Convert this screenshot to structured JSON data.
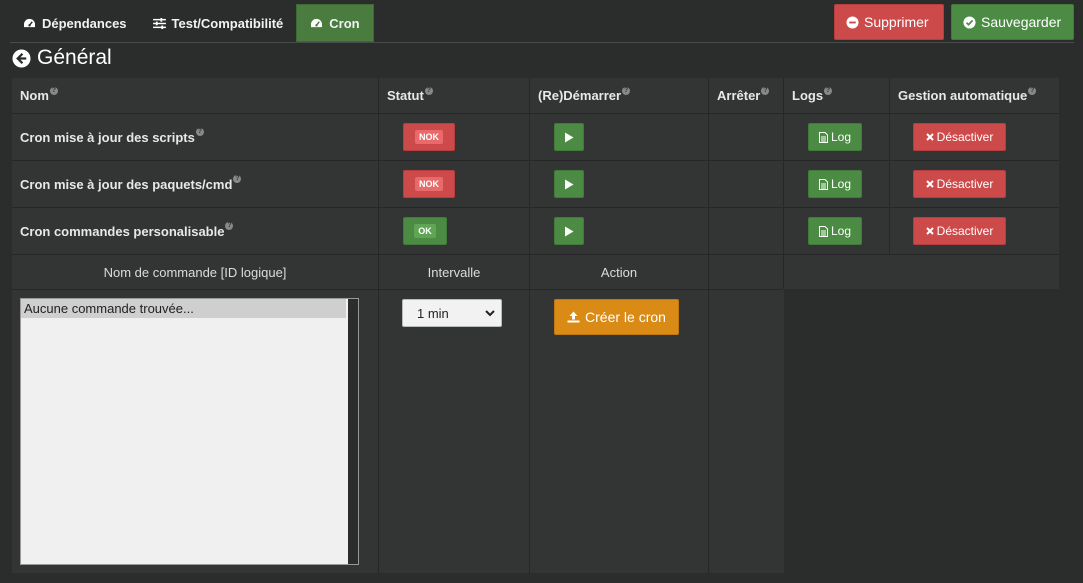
{
  "tabs": [
    {
      "label": "Dépendances",
      "icon": "dashboard-icon"
    },
    {
      "label": "Test/Compatibilité",
      "icon": "sliders-icon"
    },
    {
      "label": "Cron",
      "icon": "dashboard-icon",
      "active": true
    }
  ],
  "actions": {
    "delete_label": "Supprimer",
    "save_label": "Sauvegarder"
  },
  "section": {
    "title": "Général",
    "icon": "arrow-circle-left-icon"
  },
  "table": {
    "headers": {
      "name": "Nom",
      "status": "Statut",
      "restart": "(Re)Démarrer",
      "stop": "Arrêter",
      "logs": "Logs",
      "auto": "Gestion automatique"
    },
    "rows": [
      {
        "name": "Cron mise à jour des scripts",
        "status": "NOK",
        "log_label": "Log",
        "deactivate_label": "Désactiver"
      },
      {
        "name": "Cron mise à jour des paquets/cmd",
        "status": "NOK",
        "log_label": "Log",
        "deactivate_label": "Désactiver"
      },
      {
        "name": "Cron commandes personalisable",
        "status": "OK",
        "log_label": "Log",
        "deactivate_label": "Désactiver"
      }
    ]
  },
  "command_section": {
    "headers": {
      "command": "Nom de commande [ID logique]",
      "interval": "Intervalle",
      "action": "Action"
    },
    "list_placeholder": "Aucune commande trouvée...",
    "interval_value": "1 min",
    "create_label": "Créer le cron"
  },
  "colors": {
    "success": "#4c8b43",
    "danger": "#cc4a4a",
    "warning": "#d98b16",
    "background": "#2b2c2c"
  }
}
